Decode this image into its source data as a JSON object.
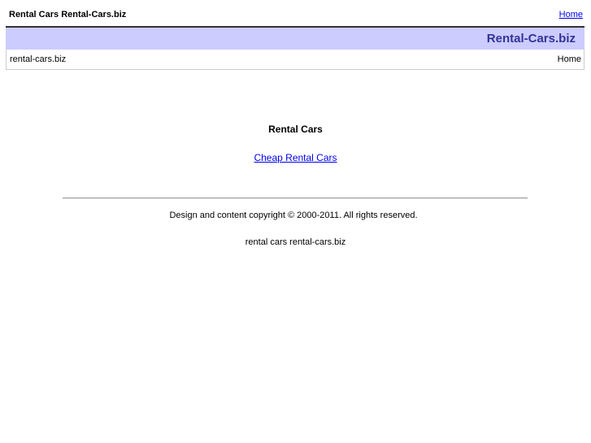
{
  "top_bar": {
    "site_title": "Rental Cars Rental-Cars.biz",
    "home_link": "Home"
  },
  "header": {
    "brand_name": "Rental-Cars.biz"
  },
  "breadcrumb": {
    "domain": "rental-cars.biz",
    "home": "Home"
  },
  "main": {
    "heading": "Rental Cars",
    "link_text": "Cheap Rental Cars"
  },
  "footer": {
    "copyright": "Design and content copyright © 2000-2011. All rights reserved.",
    "keywords": "rental cars rental-cars.biz"
  },
  "colors": {
    "header_band": "#ccccff",
    "brand_text": "#333399",
    "link": "#0000ee"
  }
}
